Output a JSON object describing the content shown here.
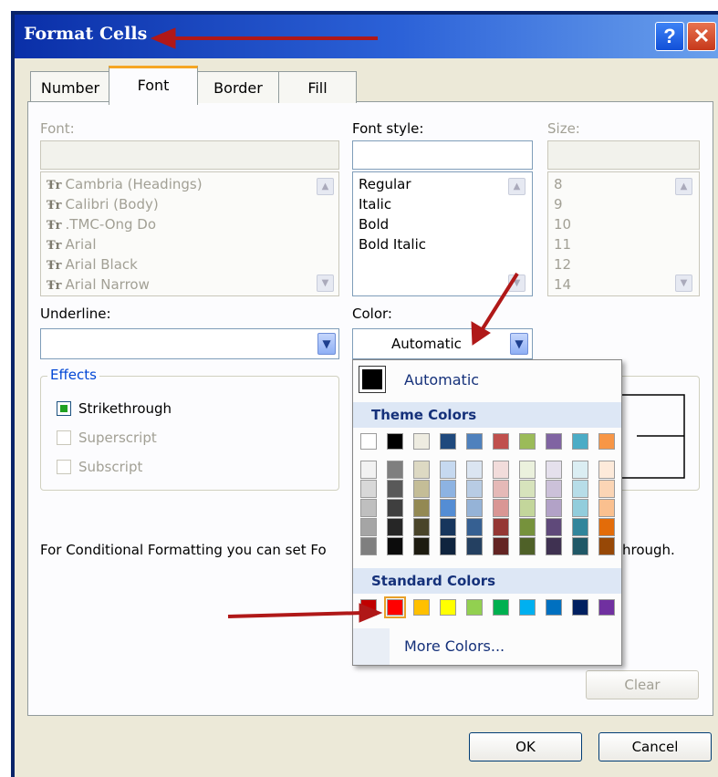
{
  "window": {
    "title": "Format Cells",
    "help_glyph": "?",
    "close_glyph": "✕"
  },
  "tabs": [
    "Number",
    "Font",
    "Border",
    "Fill"
  ],
  "font": {
    "label": "Font:",
    "value": "",
    "items": [
      "Cambria (Headings)",
      "Calibri (Body)",
      ".TMC-Ong Do",
      "Arial",
      "Arial Black",
      "Arial Narrow"
    ]
  },
  "font_style": {
    "label": "Font style:",
    "value": "",
    "items": [
      "Regular",
      "Italic",
      "Bold",
      "Bold Italic"
    ]
  },
  "size": {
    "label": "Size:",
    "value": "",
    "items": [
      "8",
      "9",
      "10",
      "11",
      "12",
      "14"
    ]
  },
  "underline": {
    "label": "Underline:",
    "value": ""
  },
  "color": {
    "label": "Color:",
    "value": "Automatic"
  },
  "effects": {
    "label": "Effects",
    "strikethrough": {
      "label": "Strikethrough",
      "checked": true
    },
    "superscript": {
      "label": "Superscript",
      "checked": false
    },
    "subscript": {
      "label": "Subscript",
      "checked": false
    }
  },
  "info_text_left": "For Conditional Formatting you can set Fo",
  "info_text_right": "hrough.",
  "popup": {
    "automatic_label": "Automatic",
    "theme_header": "Theme Colors",
    "standard_header": "Standard Colors",
    "more_colors": "More Colors...",
    "theme_top": [
      "#ffffff",
      "#000000",
      "#eeece1",
      "#1f497d",
      "#4f81bd",
      "#c0504d",
      "#9bbb59",
      "#8064a2",
      "#4bacc6",
      "#f79646"
    ],
    "theme_shades": [
      [
        "#f2f2f2",
        "#d8d8d8",
        "#bfbfbf",
        "#a5a5a5",
        "#7f7f7f"
      ],
      [
        "#7f7f7f",
        "#595959",
        "#3f3f3f",
        "#262626",
        "#0c0c0c"
      ],
      [
        "#ddd9c3",
        "#c4bd97",
        "#938953",
        "#494429",
        "#1d1b10"
      ],
      [
        "#c6d9f0",
        "#8db3e2",
        "#548dd4",
        "#17365d",
        "#0f243e"
      ],
      [
        "#dbe5f1",
        "#b8cce4",
        "#95b3d7",
        "#366092",
        "#244061"
      ],
      [
        "#f2dcdb",
        "#e5b9b7",
        "#d99694",
        "#953734",
        "#632423"
      ],
      [
        "#ebf1dd",
        "#d7e3bc",
        "#c3d69b",
        "#76923c",
        "#4f6128"
      ],
      [
        "#e5e0ec",
        "#ccc1d9",
        "#b2a2c7",
        "#5f497a",
        "#3f3151"
      ],
      [
        "#dbeef3",
        "#b7dde8",
        "#92cddc",
        "#31859b",
        "#205867"
      ],
      [
        "#fdeada",
        "#fbd5b5",
        "#fac08f",
        "#e36c09",
        "#974806"
      ]
    ],
    "standard": [
      "#c00000",
      "#ff0000",
      "#ffc000",
      "#ffff00",
      "#92d050",
      "#00b050",
      "#00b0f0",
      "#0070c0",
      "#002060",
      "#7030a0"
    ]
  },
  "buttons": {
    "clear": "Clear",
    "ok": "OK",
    "cancel": "Cancel"
  }
}
